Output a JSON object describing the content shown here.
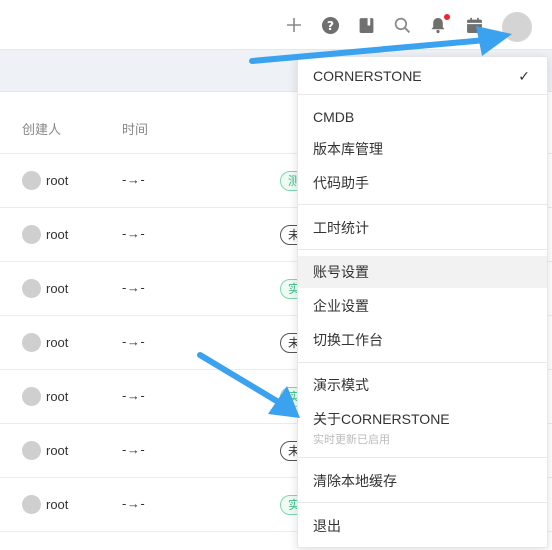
{
  "header": {
    "icons": [
      "plus-icon",
      "help-icon",
      "book-icon",
      "search-icon",
      "bell-icon",
      "calendar-icon"
    ],
    "notification_dot_color": "#f5222d"
  },
  "table": {
    "columns": {
      "creator": "创建人",
      "time": "时间"
    },
    "rows": [
      {
        "creator": "root",
        "time": "-→-",
        "tag": "测",
        "tag_style": "green"
      },
      {
        "creator": "root",
        "time": "-→-",
        "tag": "未",
        "tag_style": "dark"
      },
      {
        "creator": "root",
        "time": "-→-",
        "tag": "实",
        "tag_style": "green"
      },
      {
        "creator": "root",
        "time": "-→-",
        "tag": "未",
        "tag_style": "dark"
      },
      {
        "creator": "root",
        "time": "-→-",
        "tag": "实",
        "tag_style": "green"
      },
      {
        "creator": "root",
        "time": "-→-",
        "tag": "未",
        "tag_style": "dark"
      },
      {
        "creator": "root",
        "time": "-→-",
        "tag": "实",
        "tag_style": "green"
      }
    ]
  },
  "menu": {
    "workspace": "CORNERSTONE",
    "check_mark": "✓",
    "cmdb": "CMDB",
    "repo_mgmt": "版本库管理",
    "code_assistant": "代码助手",
    "work_hours": "工时统计",
    "account_settings": "账号设置",
    "enterprise_settings": "企业设置",
    "switch_workbench": "切换工作台",
    "demo_mode": "演示模式",
    "about": "关于CORNERSTONE",
    "about_sub": "实时更新已启用",
    "clear_cache": "清除本地缓存",
    "logout": "退出"
  },
  "annotation_color": "#3ba2f0"
}
